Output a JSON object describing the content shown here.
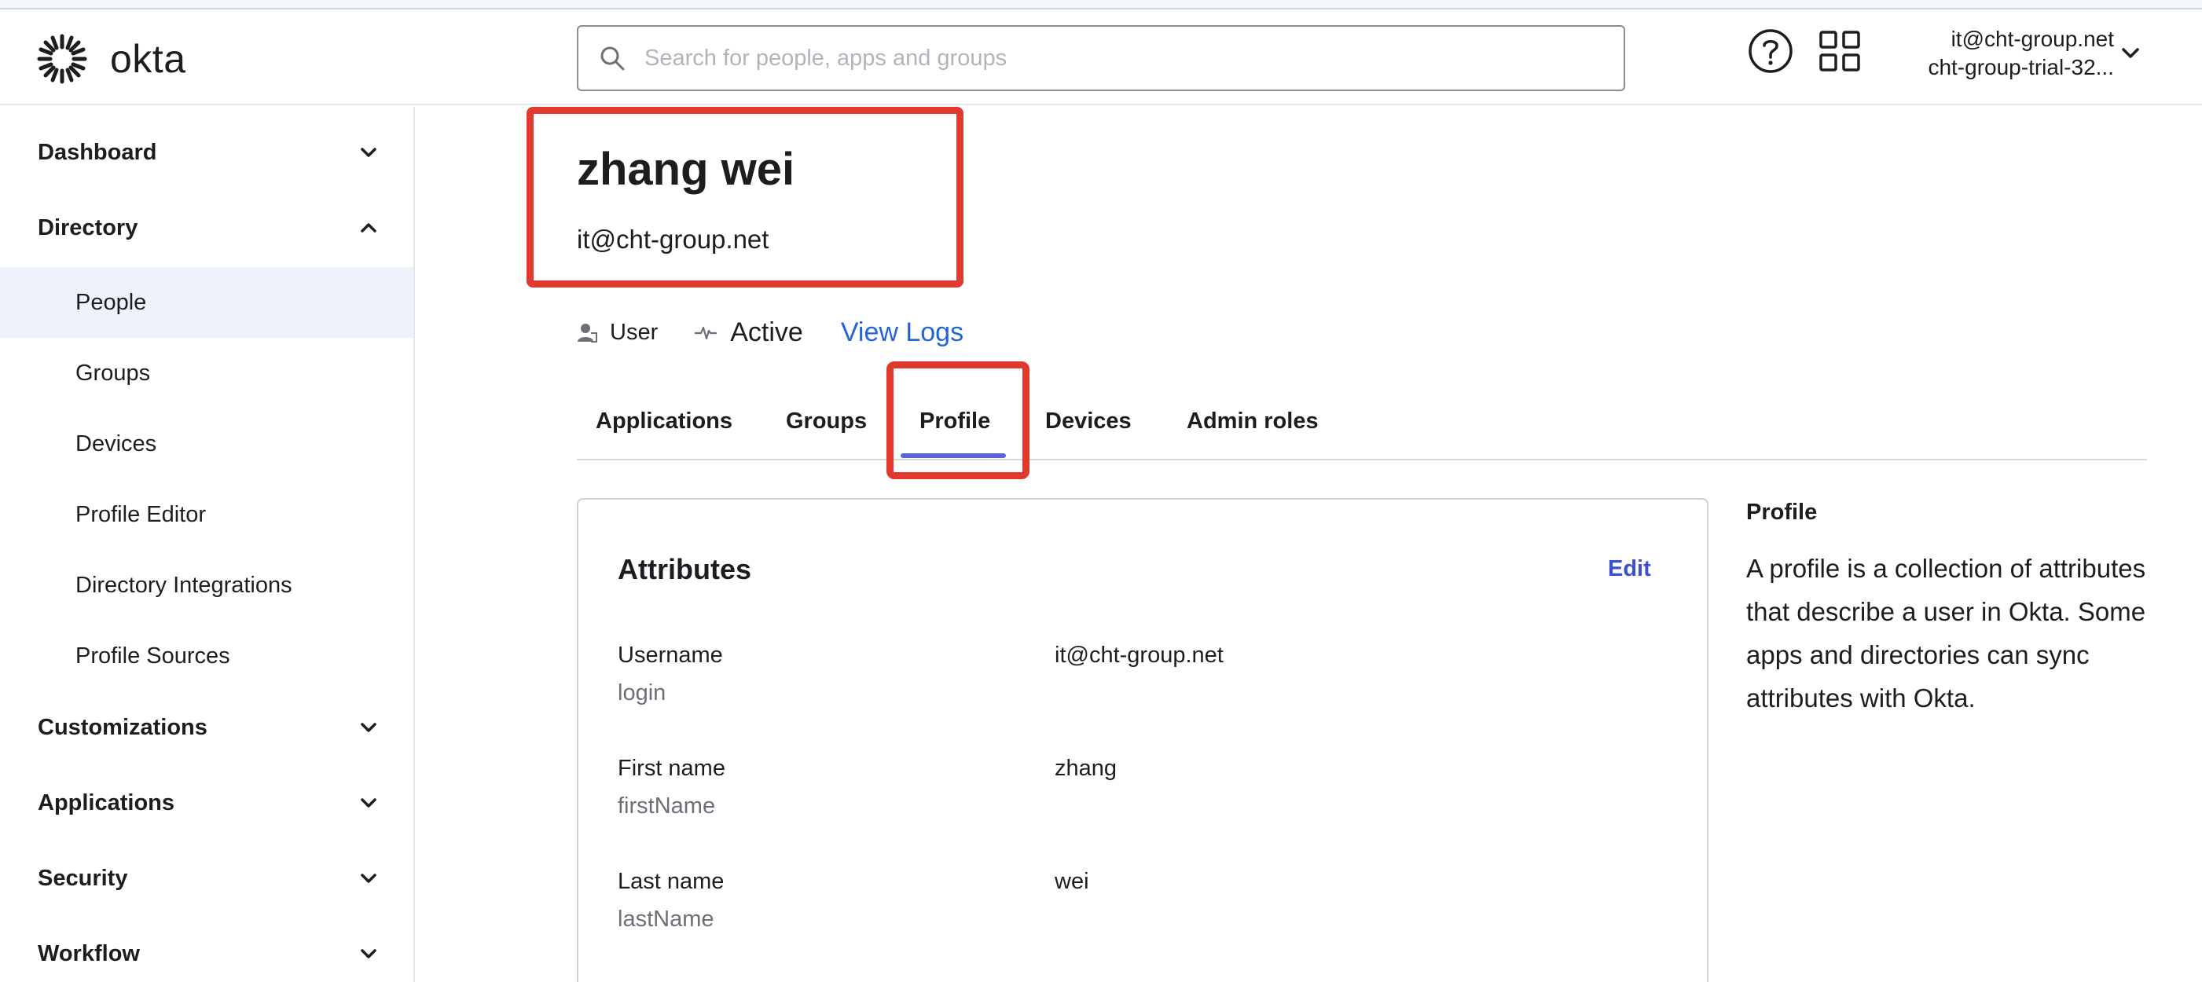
{
  "app": {
    "logo_text": "okta"
  },
  "search": {
    "placeholder": "Search for people, apps and groups"
  },
  "account": {
    "email": "it@cht-group.net",
    "org": "cht-group-trial-32..."
  },
  "sidebar": {
    "sections": [
      {
        "label": "Dashboard",
        "expanded": false
      },
      {
        "label": "Directory",
        "expanded": true
      },
      {
        "label": "Customizations",
        "expanded": false
      },
      {
        "label": "Applications",
        "expanded": false
      },
      {
        "label": "Security",
        "expanded": false
      },
      {
        "label": "Workflow",
        "expanded": false
      }
    ],
    "directory_items": [
      {
        "label": "People",
        "active": true
      },
      {
        "label": "Groups"
      },
      {
        "label": "Devices"
      },
      {
        "label": "Profile Editor"
      },
      {
        "label": "Directory Integrations"
      },
      {
        "label": "Profile Sources"
      }
    ]
  },
  "user": {
    "name": "zhang wei",
    "email": "it@cht-group.net",
    "type": "User",
    "status": "Active",
    "view_logs": "View Logs"
  },
  "tabs": [
    {
      "label": "Applications"
    },
    {
      "label": "Groups"
    },
    {
      "label": "Profile",
      "active": true
    },
    {
      "label": "Devices"
    },
    {
      "label": "Admin roles"
    }
  ],
  "attributes": {
    "title": "Attributes",
    "edit_label": "Edit",
    "rows": [
      {
        "label": "Username",
        "key": "login",
        "value": "it@cht-group.net"
      },
      {
        "label": "First name",
        "key": "firstName",
        "value": "zhang"
      },
      {
        "label": "Last name",
        "key": "lastName",
        "value": "wei"
      }
    ]
  },
  "help_panel": {
    "title": "Profile",
    "description": "A profile is a collection of attributes that describe a user in Okta. Some apps and directories can sync attributes with Okta."
  },
  "colors": {
    "accent": "#5a64dc",
    "link": "#2563d9",
    "highlight": "#e03a2e",
    "active_nav_bg": "#f0f2fb"
  }
}
